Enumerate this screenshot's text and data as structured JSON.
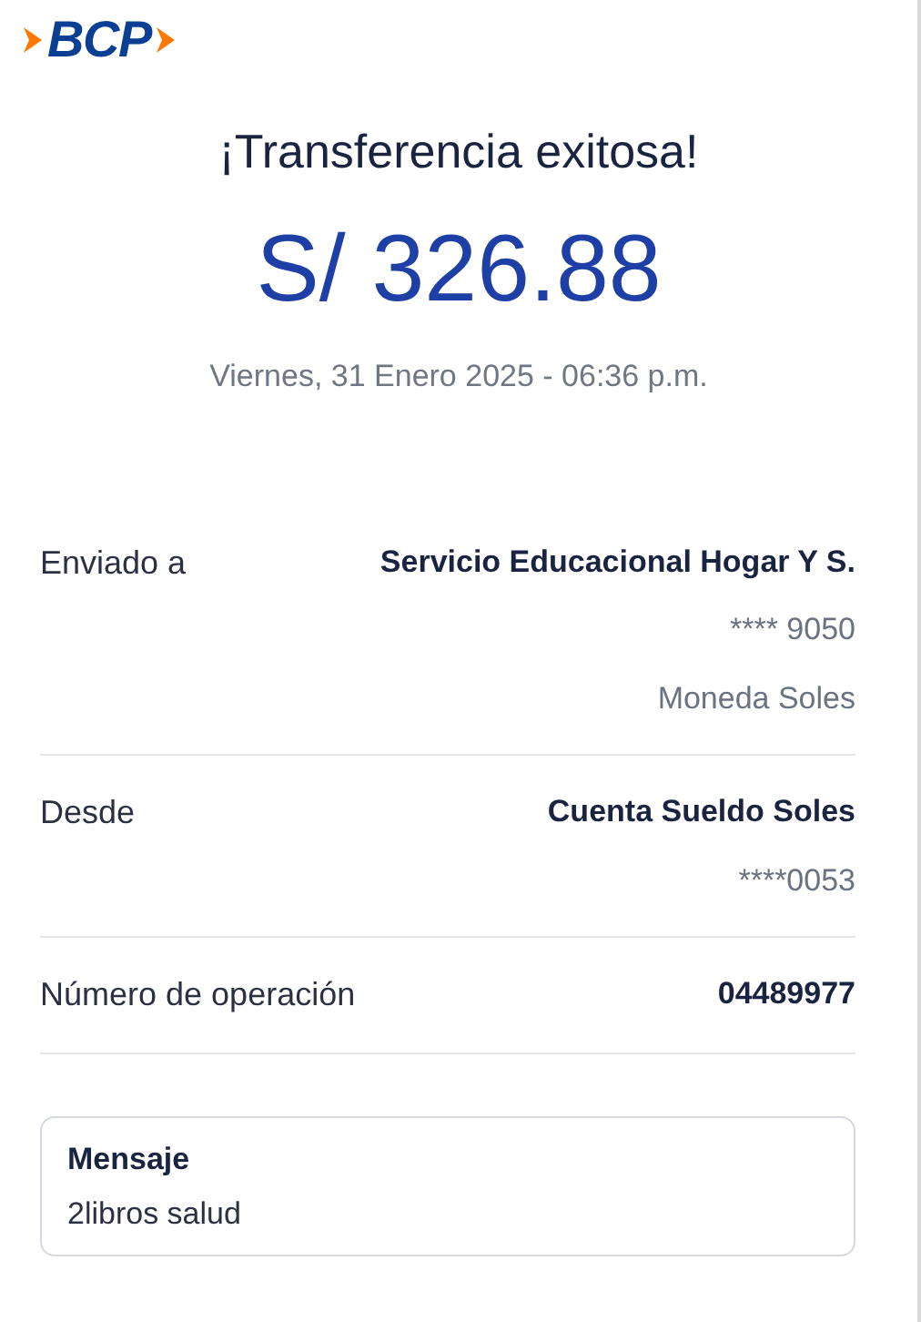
{
  "header": {
    "logo": "BCP"
  },
  "title": "¡Transferencia exitosa!",
  "amount": "S/ 326.88",
  "date": "Viernes, 31 Enero 2025 - 06:36 p.m.",
  "details": [
    {
      "label": "Enviado a",
      "values": [
        "Servicio Educacional Hogar Y S.",
        "**** 9050",
        "Moneda Soles"
      ]
    },
    {
      "label": "Desde",
      "values": [
        "Cuenta Sueldo Soles",
        "****0053"
      ]
    },
    {
      "label": "Número de operación",
      "values": [
        "04489977"
      ]
    }
  ],
  "message": {
    "label": "Mensaje",
    "text": "2libros salud"
  }
}
